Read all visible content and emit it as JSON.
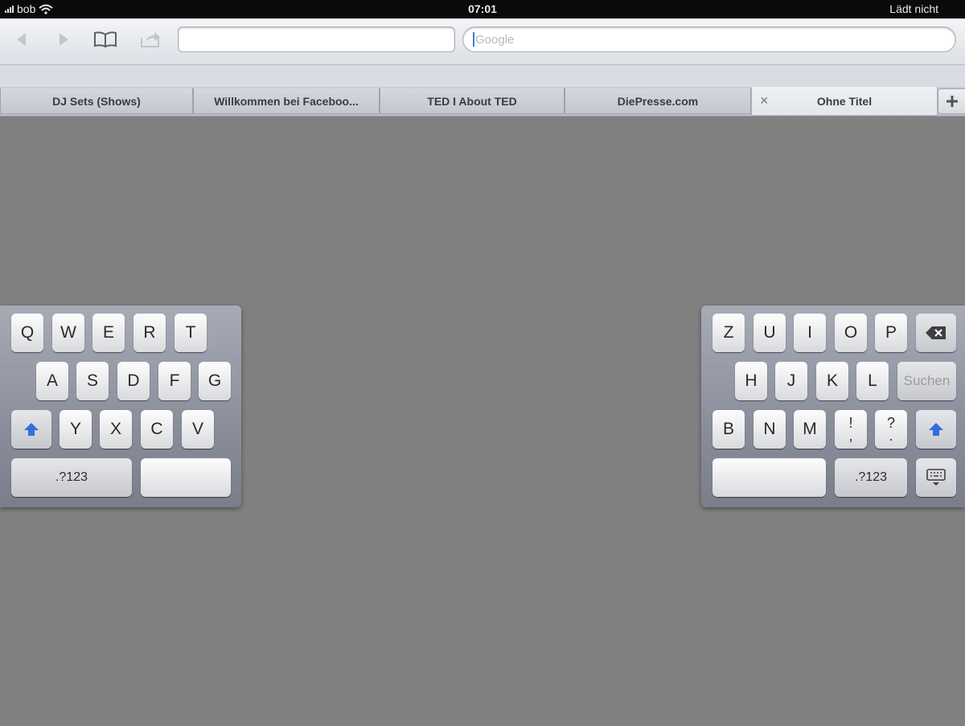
{
  "status_bar": {
    "carrier": "bob",
    "time": "07:01",
    "loading_status": "Lädt nicht"
  },
  "toolbar": {
    "icons": [
      "back-icon",
      "forward-icon",
      "bookmarks-icon",
      "share-icon"
    ],
    "url_value": "",
    "search_placeholder": "Google"
  },
  "tabs": [
    {
      "title": "DJ Sets (Shows)"
    },
    {
      "title": "Willkommen bei Faceboo..."
    },
    {
      "title": "TED I About TED"
    },
    {
      "title": "DiePresse.com"
    },
    {
      "title": "Ohne Titel",
      "active": true
    }
  ],
  "tab_close_glyph": "×",
  "keyboard": {
    "left": {
      "row1": [
        "Q",
        "W",
        "E",
        "R",
        "T"
      ],
      "row2": [
        "A",
        "S",
        "D",
        "F",
        "G"
      ],
      "row3": [
        "Y",
        "X",
        "C",
        "V"
      ],
      "numbers_label": ".?123"
    },
    "right": {
      "row1": [
        "Z",
        "U",
        "I",
        "O",
        "P"
      ],
      "row2": [
        "H",
        "J",
        "K",
        "L"
      ],
      "search_label": "Suchen",
      "row3": [
        "B",
        "N",
        "M"
      ],
      "punct1": [
        "!",
        ","
      ],
      "punct2": [
        "?",
        "."
      ],
      "numbers_label": ".?123"
    }
  },
  "colors": {
    "accent": "#3a7bd5",
    "background": "#808080",
    "shift_arrow": "#2f6fe0"
  }
}
